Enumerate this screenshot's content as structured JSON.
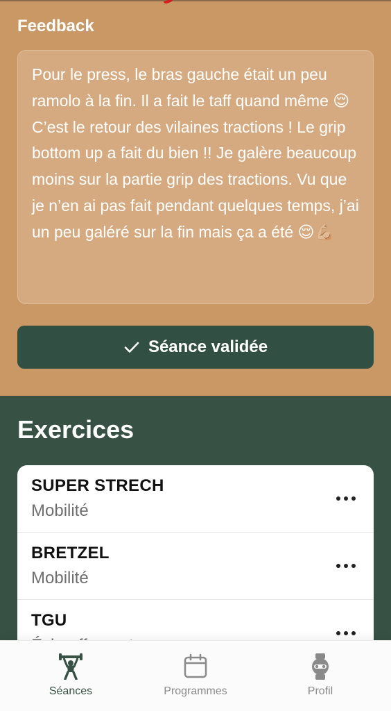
{
  "feedback": {
    "title": "Feedback",
    "text": "Pour le press, le bras gauche était un peu ramolo à la fin. Il a fait le taff quand même 😌\nC’est le retour des vilaines tractions ! Le grip bottom up a fait du bien !! Je galère beaucoup moins sur la partie grip des tractions. Vu que je n’en ai pas fait pendant quelques temps, j’ai un peu galéré sur la fin mais ça a été 😌💪🏼"
  },
  "validate_button": {
    "label": "Séance validée",
    "icon": "check-icon"
  },
  "exercises": {
    "title": "Exercices",
    "items": [
      {
        "name": "SUPER STRECH",
        "category": "Mobilité"
      },
      {
        "name": "BRETZEL",
        "category": "Mobilité"
      },
      {
        "name": "TGU",
        "category": "Échauffement"
      }
    ]
  },
  "bottom_nav": {
    "items": [
      {
        "label": "Séances",
        "icon": "weightlifter-icon",
        "active": true
      },
      {
        "label": "Programmes",
        "icon": "calendar-icon",
        "active": false
      },
      {
        "label": "Profil",
        "icon": "smartwatch-icon",
        "active": false
      }
    ]
  },
  "colors": {
    "feedback_background": "#c99864",
    "feedback_box": "#d5aa80",
    "primary_dark_green": "#375144",
    "button_green": "#324f43",
    "card_background": "#ffffff"
  }
}
